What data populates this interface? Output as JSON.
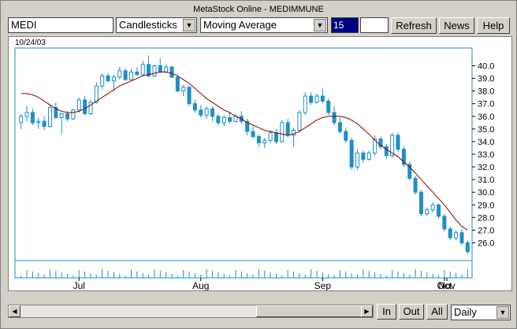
{
  "window": {
    "title": "MetaStock Online - MEDIMMUNE"
  },
  "toolbar": {
    "symbol": "MEDI",
    "chart_style": "Candlesticks",
    "indicator": "Moving Average",
    "period": "15",
    "refresh_label": "Refresh",
    "news_label": "News",
    "help_label": "Help"
  },
  "footer": {
    "in_label": "In",
    "out_label": "Out",
    "all_label": "All",
    "interval": "Daily"
  },
  "icons": {
    "dropdown": "chevron-down-icon",
    "scroll_left": "arrow-left-icon",
    "scroll_right": "arrow-right-icon"
  },
  "colors": {
    "up_candle": "#ffffff",
    "down_candle": "#1f8fc8",
    "moving_average": "#8b0000",
    "period_highlight": "#000080"
  },
  "chart_data": {
    "type": "candlestick",
    "date_label": "10/24/03",
    "x_tick_labels": [
      "Jul",
      "Aug",
      "Sep",
      "Oct",
      "Nov"
    ],
    "y_ticks": [
      26.0,
      27.0,
      28.0,
      29.0,
      30.0,
      31.0,
      32.0,
      33.0,
      34.0,
      35.0,
      36.0,
      37.0,
      38.0,
      39.0,
      40.0
    ],
    "ylim": [
      24.6,
      41.4
    ],
    "y_labels_side": "right",
    "grid": false,
    "indicator": {
      "name": "Moving Average",
      "period": 15
    },
    "moving_average": [
      37.8,
      37.8,
      37.7,
      37.5,
      37.2,
      36.9,
      36.6,
      36.4,
      36.3,
      36.3,
      36.4,
      36.6,
      36.9,
      37.2,
      37.5,
      37.8,
      38.1,
      38.4,
      38.6,
      38.8,
      39.0,
      39.2,
      39.3,
      39.4,
      39.5,
      39.5,
      39.4,
      39.2,
      38.9,
      38.6,
      38.2,
      37.8,
      37.4,
      37.1,
      36.8,
      36.5,
      36.3,
      36.0,
      35.8,
      35.5,
      35.3,
      35.1,
      34.9,
      34.8,
      34.7,
      34.6,
      34.5,
      34.6,
      34.8,
      35.1,
      35.4,
      35.7,
      35.9,
      36.0,
      36.0,
      36.0,
      35.9,
      35.7,
      35.4,
      35.0,
      34.6,
      34.1,
      33.7,
      33.4,
      33.1,
      32.8,
      32.4,
      32.0,
      31.5,
      31.0,
      30.5,
      30.0,
      29.5,
      29.0,
      28.4,
      27.8,
      27.3,
      27.0
    ],
    "ohlc": [
      [
        35.5,
        36.2,
        35.0,
        36.0
      ],
      [
        36.0,
        36.8,
        35.6,
        36.3
      ],
      [
        36.3,
        36.6,
        35.3,
        35.5
      ],
      [
        35.5,
        35.9,
        35.0,
        35.6
      ],
      [
        35.6,
        36.0,
        34.9,
        35.2
      ],
      [
        35.2,
        36.9,
        35.1,
        36.7
      ],
      [
        36.7,
        37.1,
        35.8,
        35.9
      ],
      [
        35.9,
        36.3,
        34.6,
        36.2
      ],
      [
        36.2,
        36.4,
        35.6,
        35.8
      ],
      [
        35.8,
        36.6,
        35.7,
        36.5
      ],
      [
        36.5,
        37.5,
        36.3,
        37.3
      ],
      [
        37.3,
        37.6,
        36.1,
        36.2
      ],
      [
        36.2,
        37.3,
        36.1,
        37.1
      ],
      [
        37.1,
        38.7,
        37.0,
        38.4
      ],
      [
        38.4,
        39.4,
        38.1,
        39.2
      ],
      [
        39.2,
        39.4,
        38.7,
        38.8
      ],
      [
        38.8,
        39.3,
        38.0,
        39.1
      ],
      [
        39.1,
        39.9,
        38.9,
        39.6
      ],
      [
        39.6,
        39.8,
        38.8,
        38.9
      ],
      [
        38.9,
        39.8,
        38.8,
        39.5
      ],
      [
        39.5,
        39.9,
        39.2,
        39.3
      ],
      [
        39.3,
        40.4,
        39.2,
        40.1
      ],
      [
        40.1,
        40.8,
        39.1,
        39.2
      ],
      [
        39.2,
        40.1,
        39.1,
        40.0
      ],
      [
        40.0,
        40.6,
        39.4,
        39.5
      ],
      [
        39.5,
        40.1,
        39.4,
        39.9
      ],
      [
        39.9,
        40.0,
        39.0,
        39.1
      ],
      [
        39.1,
        39.3,
        37.9,
        38.0
      ],
      [
        38.0,
        38.5,
        37.6,
        38.3
      ],
      [
        38.3,
        38.4,
        36.8,
        37.0
      ],
      [
        37.0,
        37.3,
        36.3,
        36.5
      ],
      [
        36.5,
        36.9,
        35.9,
        36.1
      ],
      [
        36.1,
        36.8,
        35.8,
        36.6
      ],
      [
        36.6,
        36.8,
        35.6,
        36.0
      ],
      [
        36.0,
        36.2,
        35.3,
        35.5
      ],
      [
        35.5,
        36.1,
        35.2,
        35.9
      ],
      [
        35.9,
        36.3,
        35.4,
        35.6
      ],
      [
        35.6,
        36.2,
        35.5,
        36.0
      ],
      [
        36.0,
        36.4,
        35.4,
        35.6
      ],
      [
        35.6,
        35.8,
        34.5,
        34.8
      ],
      [
        34.8,
        35.2,
        34.2,
        34.4
      ],
      [
        34.4,
        34.6,
        33.6,
        33.9
      ],
      [
        33.9,
        34.3,
        33.5,
        34.1
      ],
      [
        34.1,
        34.9,
        33.9,
        34.7
      ],
      [
        34.7,
        35.0,
        33.8,
        34.0
      ],
      [
        34.0,
        35.7,
        33.9,
        35.5
      ],
      [
        35.5,
        35.8,
        34.3,
        34.5
      ],
      [
        34.5,
        35.1,
        33.6,
        34.9
      ],
      [
        34.9,
        36.5,
        34.7,
        36.3
      ],
      [
        36.3,
        37.9,
        36.1,
        37.6
      ],
      [
        37.6,
        37.9,
        36.9,
        37.1
      ],
      [
        37.1,
        37.8,
        37.0,
        37.6
      ],
      [
        37.6,
        38.2,
        37.0,
        37.2
      ],
      [
        37.2,
        37.4,
        36.1,
        36.3
      ],
      [
        36.3,
        36.8,
        35.3,
        35.5
      ],
      [
        35.5,
        35.9,
        34.6,
        34.8
      ],
      [
        34.8,
        35.1,
        33.9,
        34.1
      ],
      [
        34.1,
        34.3,
        31.8,
        32.0
      ],
      [
        32.0,
        33.4,
        31.8,
        33.1
      ],
      [
        33.1,
        33.3,
        32.3,
        32.6
      ],
      [
        32.6,
        33.3,
        32.5,
        33.1
      ],
      [
        33.1,
        34.5,
        32.9,
        34.2
      ],
      [
        34.2,
        34.4,
        33.4,
        33.6
      ],
      [
        33.6,
        33.8,
        32.6,
        32.9
      ],
      [
        32.9,
        34.7,
        32.7,
        34.5
      ],
      [
        34.5,
        34.7,
        33.2,
        33.4
      ],
      [
        33.4,
        33.6,
        32.0,
        32.2
      ],
      [
        32.2,
        32.4,
        30.9,
        31.1
      ],
      [
        31.1,
        31.3,
        29.8,
        30.0
      ],
      [
        30.0,
        30.2,
        28.1,
        28.3
      ],
      [
        28.3,
        28.8,
        28.1,
        28.6
      ],
      [
        28.6,
        29.2,
        28.4,
        29.0
      ],
      [
        29.0,
        29.1,
        27.9,
        28.1
      ],
      [
        28.1,
        28.3,
        26.9,
        27.1
      ],
      [
        27.1,
        27.3,
        26.2,
        26.4
      ],
      [
        26.4,
        27.0,
        26.2,
        26.8
      ],
      [
        26.8,
        27.1,
        25.8,
        26.0
      ],
      [
        26.0,
        26.2,
        25.1,
        25.3
      ]
    ]
  }
}
